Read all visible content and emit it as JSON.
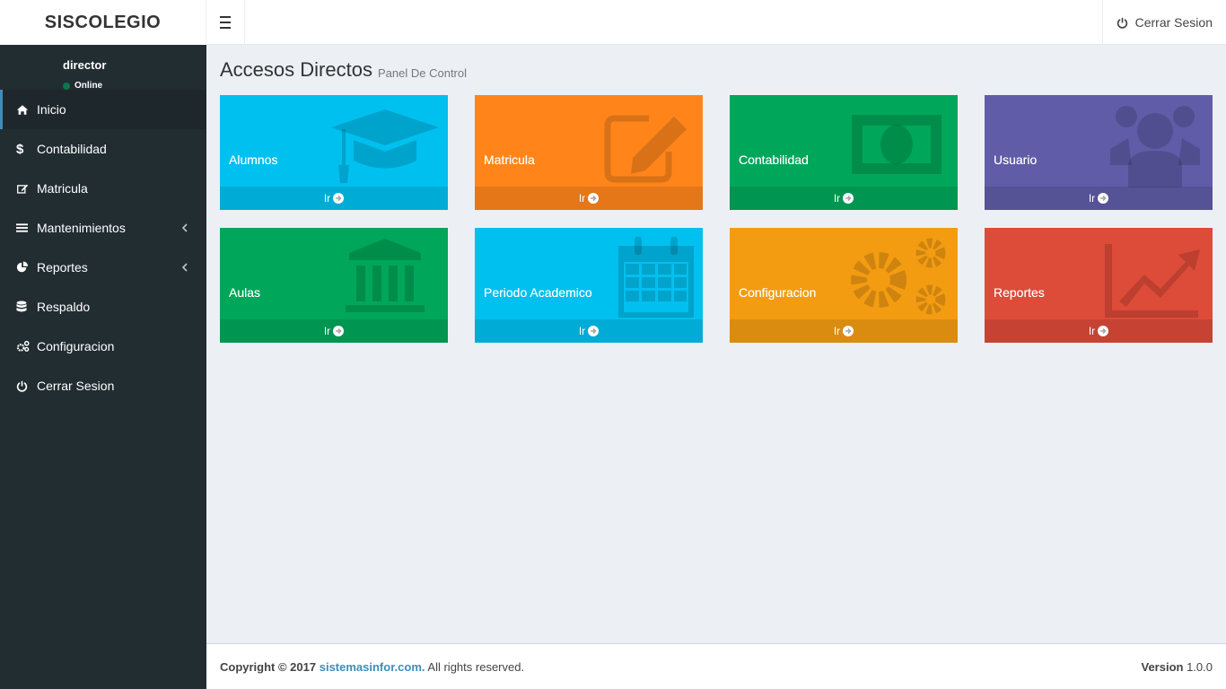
{
  "header": {
    "brand": "SISCOLEGIO",
    "logout_label": "Cerrar Sesion"
  },
  "user": {
    "name": "director",
    "status": "Online"
  },
  "sidebar": {
    "items": [
      {
        "label": "Inicio",
        "icon": "home-icon"
      },
      {
        "label": "Contabilidad",
        "icon": "dollar-icon"
      },
      {
        "label": "Matricula",
        "icon": "edit-icon"
      },
      {
        "label": "Mantenimientos",
        "icon": "list-icon"
      },
      {
        "label": "Reportes",
        "icon": "pie-chart-icon"
      },
      {
        "label": "Respaldo",
        "icon": "database-icon"
      },
      {
        "label": "Configuracion",
        "icon": "cogs-icon"
      },
      {
        "label": "Cerrar Sesion",
        "icon": "power-icon"
      }
    ]
  },
  "page": {
    "title": "Accesos Directos",
    "subtitle": "Panel De Control"
  },
  "tiles": [
    {
      "label": "Alumnos",
      "footer": "Ir",
      "color": "#00c0ef",
      "icon": "graduation-cap-icon"
    },
    {
      "label": "Matricula",
      "footer": "Ir",
      "color": "#ff851b",
      "icon": "edit-icon"
    },
    {
      "label": "Contabilidad",
      "footer": "Ir",
      "color": "#00a65a",
      "icon": "money-icon"
    },
    {
      "label": "Usuario",
      "footer": "Ir",
      "color": "#605ca8",
      "icon": "users-icon"
    },
    {
      "label": "Aulas",
      "footer": "Ir",
      "color": "#00a65a",
      "icon": "bank-icon"
    },
    {
      "label": "Periodo Academico",
      "footer": "Ir",
      "color": "#00c0ef",
      "icon": "calendar-icon"
    },
    {
      "label": "Configuracion",
      "footer": "Ir",
      "color": "#f39c12",
      "icon": "cogs-icon"
    },
    {
      "label": "Reportes",
      "footer": "Ir",
      "color": "#dd4b39",
      "icon": "line-chart-icon"
    }
  ],
  "footer": {
    "copyright": "Copyright © 2017",
    "site": "sistemasinfor.com.",
    "rights": "All rights reserved.",
    "version_label": "Version",
    "version": "1.0.0"
  }
}
